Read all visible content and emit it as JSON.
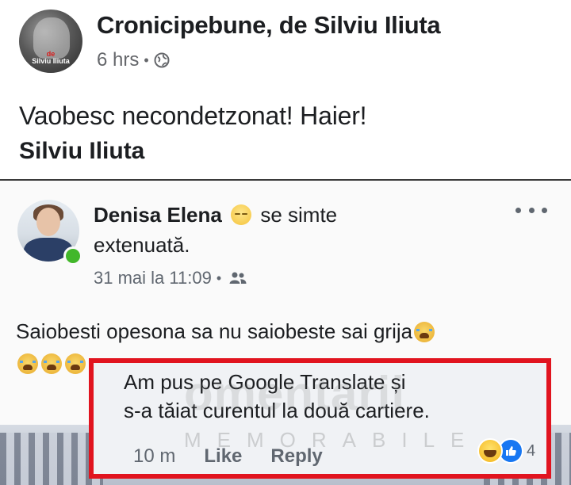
{
  "post": {
    "page_name": "Cronicipebune, de Silviu Iliuta",
    "time": "6 hrs",
    "separator": "•",
    "avatar_text_red": "de",
    "avatar_text_white": "Silviu Iliuta",
    "text": "Vaobesc necondetzonat! Haier!",
    "author": "Silviu Iliuta"
  },
  "shared": {
    "user_name": "Denisa Elena",
    "feeling_prefix": "se simte",
    "feeling_value": "extenuată.",
    "time": "31 mai la 11:09",
    "separator": "•",
    "text": "Saiobesti opesona sa nu saiobeste sai grija"
  },
  "comment": {
    "line1": "Am pus pe Google Translate și",
    "line2": "s-a tăiat curentul la două cartiere.",
    "time": "10 m",
    "like_label": "Like",
    "reply_label": "Reply",
    "reaction_count": "4"
  },
  "watermark": {
    "main": "omentarii",
    "sub": "MEMORABILE"
  },
  "colors": {
    "highlight_border": "#e1141f",
    "like_blue": "#1877f2",
    "online_green": "#42b72a"
  }
}
